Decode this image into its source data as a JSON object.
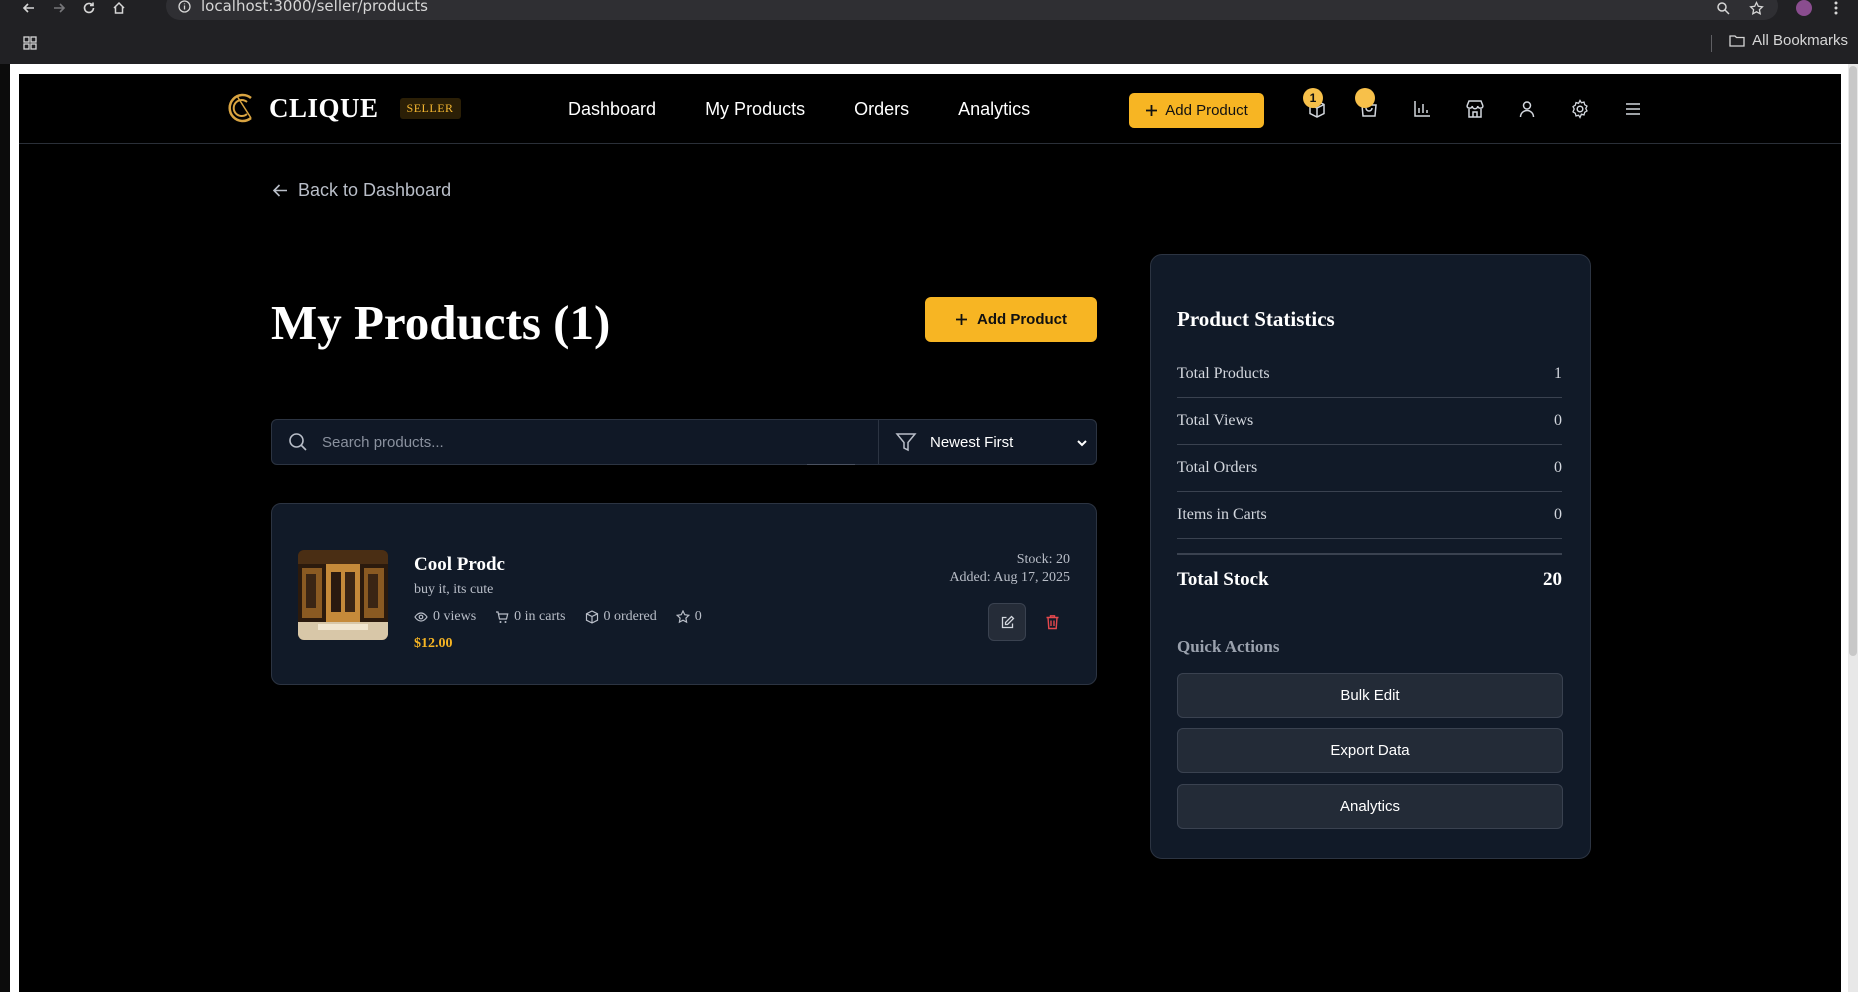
{
  "browser": {
    "url": "localhost:3000/seller/products",
    "bookmarks_label": "All Bookmarks"
  },
  "header": {
    "brand": "CLIQUE",
    "badge": "SELLER",
    "nav": [
      "Dashboard",
      "My Products",
      "Orders",
      "Analytics"
    ],
    "add_product_label": "Add Product",
    "cart_count": "1",
    "icons": [
      "box-icon",
      "shopping-bag-icon",
      "bar-chart-icon",
      "store-icon",
      "user-icon",
      "gear-icon",
      "menu-icon"
    ]
  },
  "back_link": "Back to Dashboard",
  "main": {
    "title": "My Products (1)",
    "add_product_label": "Add Product",
    "search_placeholder": "Search products...",
    "sort_value": "Newest First"
  },
  "products": [
    {
      "name": "Cool Prodc",
      "description": "buy it, its cute",
      "views": "0 views",
      "in_carts": "0 in carts",
      "ordered": "0 ordered",
      "rating": "0",
      "price": "$12.00",
      "stock": "Stock: 20",
      "added": "Added: Aug 17, 2025"
    }
  ],
  "statistics": {
    "title": "Product Statistics",
    "rows": [
      {
        "label": "Total Products",
        "value": "1"
      },
      {
        "label": "Total Views",
        "value": "0"
      },
      {
        "label": "Total Orders",
        "value": "0"
      },
      {
        "label": "Items in Carts",
        "value": "0"
      }
    ],
    "total_label": "Total Stock",
    "total_value": "20",
    "quick_actions_title": "Quick Actions",
    "quick_actions": [
      "Bulk Edit",
      "Export Data",
      "Analytics"
    ]
  },
  "colors": {
    "accent": "#f7b523",
    "background": "#000000",
    "card": "#111a28",
    "border": "#2c3442"
  }
}
